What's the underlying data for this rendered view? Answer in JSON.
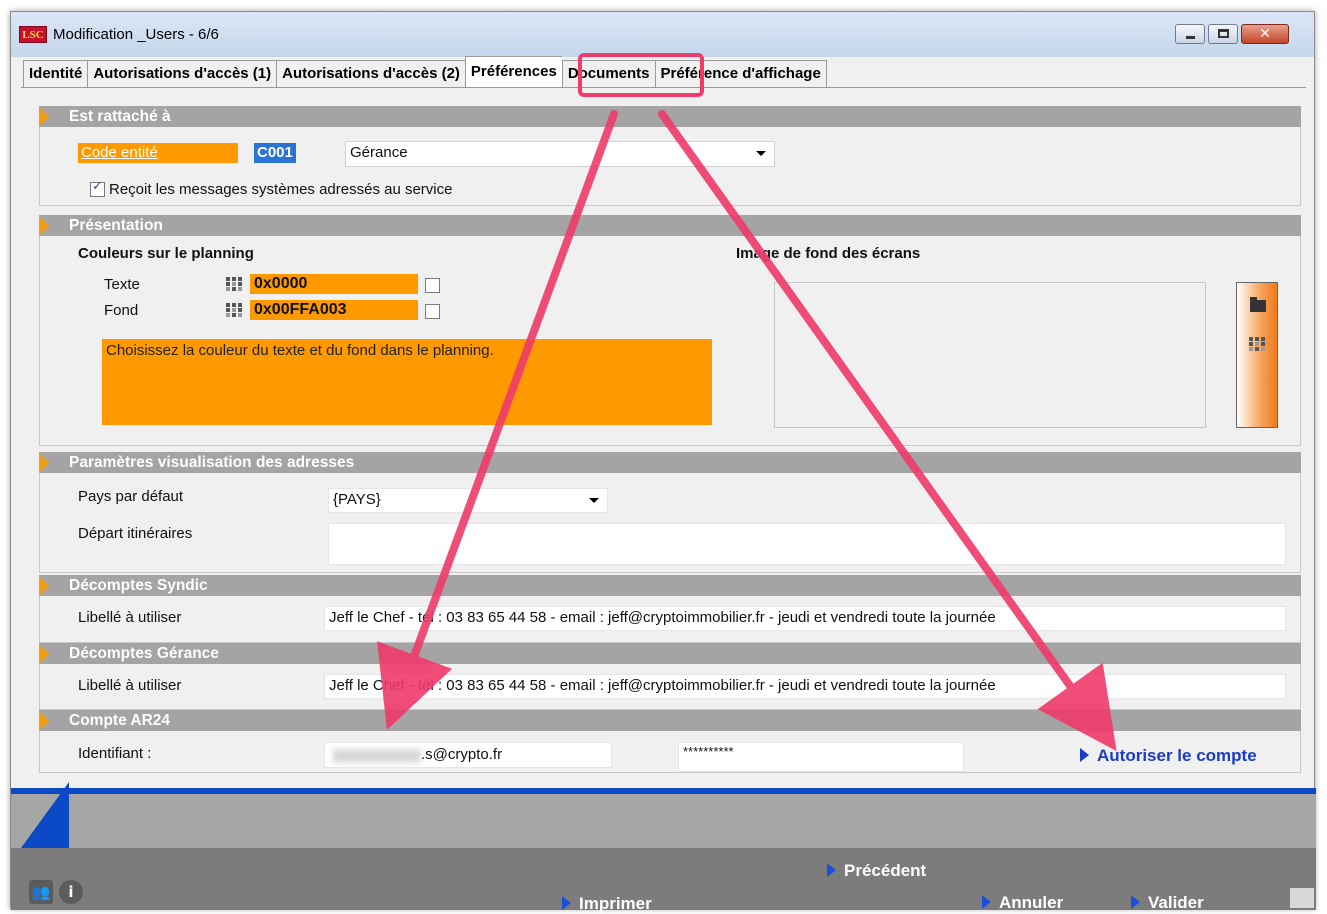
{
  "window": {
    "app_icon": "LSC",
    "title": "Modification _Users - 6/6",
    "controls": {
      "minimize_icon": "minimize-icon",
      "maximize_icon": "maximize-icon",
      "close_icon": "close-icon"
    }
  },
  "tabs": [
    {
      "label": "Identité"
    },
    {
      "label": "Autorisations d'accès (1)"
    },
    {
      "label": "Autorisations d'accès (2)"
    },
    {
      "label": "Préférences",
      "active": true
    },
    {
      "label": "Documents"
    },
    {
      "label": "Préférence d'affichage"
    }
  ],
  "sections": {
    "rattachement": {
      "title": "Est rattaché à",
      "code_label": "Code entité",
      "code_value": "C001",
      "entity_value": "Gérance",
      "checkbox_label": "Reçoit les messages systèmes adressés au service",
      "checkbox_checked": true
    },
    "presentation": {
      "title": "Présentation",
      "colors_heading": "Couleurs sur le planning",
      "text_label": "Texte",
      "text_value": "0x0000",
      "fond_label": "Fond",
      "fond_value": "0x00FFA003",
      "note": "Choisissez la couleur du texte et du fond dans le planning.",
      "image_heading": "Image de fond des écrans",
      "tools": [
        "folder-icon",
        "palette-icon"
      ]
    },
    "adresses": {
      "title": "Paramètres visualisation des adresses",
      "country_label": "Pays par défaut",
      "country_value": "{PAYS}",
      "depart_label": "Départ itinéraires",
      "depart_value": ""
    },
    "syndic": {
      "title": "Décomptes Syndic",
      "label": "Libellé à utiliser",
      "value": "Jeff le Chef - tél : 03 83 65 44 58  - email : jeff@cryptoimmobilier.fr - jeudi et vendredi toute la journée"
    },
    "gerance": {
      "title": "Décomptes Gérance",
      "label": "Libellé à utiliser",
      "value": "Jeff le Chef - tél : 03 83 65 44 58  - email : jeff@cryptoimmobilier.fr -  jeudi et vendredi toute la journée"
    },
    "ar24": {
      "title": "Compte AR24",
      "id_label": "Identifiant :",
      "id_value": ".s@crypto.fr",
      "password_value": "**********",
      "authorize_label": "Autoriser le compte"
    }
  },
  "footer": {
    "previous": "Précédent",
    "print": "Imprimer",
    "cancel": "Annuler",
    "validate": "Valider",
    "icons": [
      "users-icon",
      "info-icon"
    ]
  },
  "colors": {
    "accent_orange": "#ff9900",
    "section_gray": "#a4a4a4",
    "link_blue": "#1a3cc7",
    "annotation_pink": "#ef3a6a"
  }
}
